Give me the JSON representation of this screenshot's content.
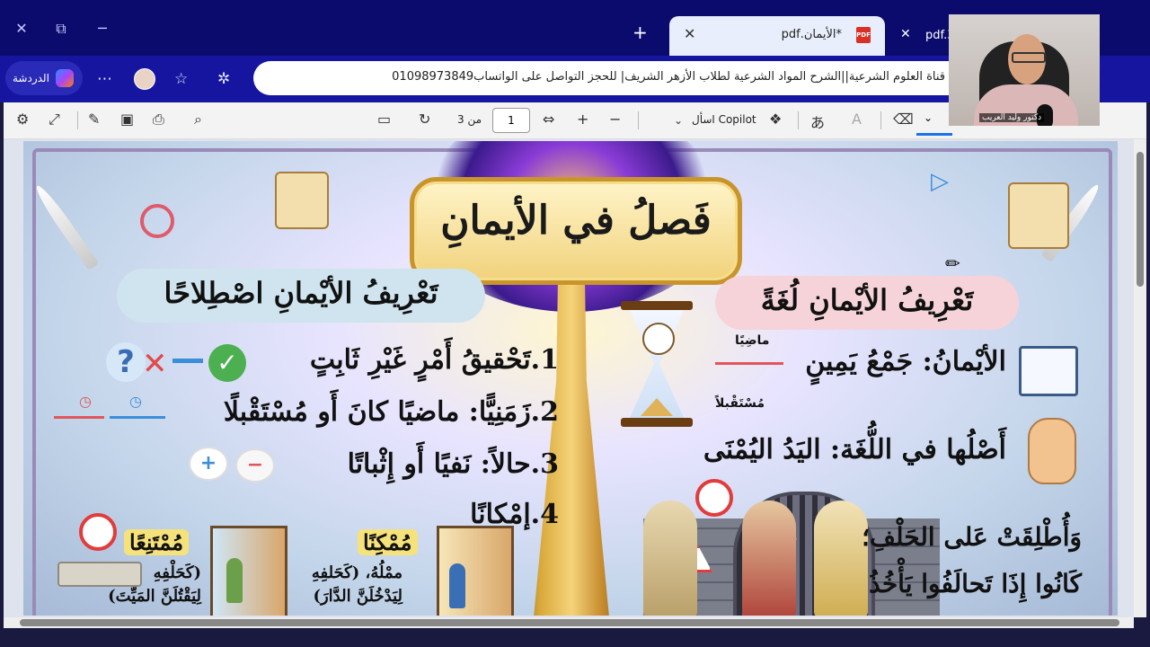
{
  "browser": {
    "tabs": [
      {
        "title": "*الأيمان.pdf",
        "active": true
      },
      {
        "title": "pdf.3"
      }
    ],
    "chat_label": "الدردشة",
    "url_text": "قناة العلوم الشرعية||الشرح المواد الشرعية لطلاب الأزهر الشريف| للحجز التواصل على الواتساب01098973849"
  },
  "pdf_toolbar": {
    "page_current": "1",
    "page_total": "من 3",
    "copilot_label": "اسأل Copilot"
  },
  "slide": {
    "title": "فَصلُ في الأيمانِ",
    "right": {
      "heading": "تَعْرِيفُ الأيْمانِ لُغَةً",
      "arrow_past": "ماضِيًا",
      "arrow_future": "مُسْتَقْبلاً",
      "line1": "الأيْمانُ: جَمْعُ يَمِينٍ",
      "line2": "أَصْلُها في اللُّغَة: اليَدُ اليُمْنَى",
      "line3": "وَأُطْلِقَتْ عَلى الحَلْفِ؛",
      "line4": "كَانُوا إِذَا تَحالَفُوا يَأْخُذُ"
    },
    "left": {
      "heading": "تَعْرِيفُ الأيْمانِ اصْطِلاحًا",
      "items": [
        "1.تَحْقيقُ أَمْرٍ غَيْرِ ثَابِتٍ",
        "2.زَمَنِيًّا: ماضيًا كانَ أَو مُسْتَقْبلًا",
        "3.حالاً: نَفيًا أَو إِثْباتًا",
        "4.إمْكانًا"
      ],
      "mumkin_label": "مُمْكِنًا",
      "mumkin_ex1": "ممْلُهُ، (كَحَلفِهِ",
      "mumkin_ex2": "لِيَدْخُلَنَّ الدَّارَ)",
      "mumtani_label": "مُمْتَنِعًا",
      "mumtani_ex1": "(كَحَلْفِهِ",
      "mumtani_ex2": "لِيَقْتُلَنَّ المَيِّتَ)"
    }
  },
  "webcam": {
    "name_label": "دكتور وليد العريب"
  },
  "icons": [
    "close-icon",
    "restore-icon",
    "minimize-icon",
    "plus-icon",
    "pdf-icon",
    "more-icon",
    "star-icon",
    "extension-icon",
    "settings-icon",
    "expand-icon",
    "edit-icon",
    "save-icon",
    "print-icon",
    "search-icon",
    "page-view-icon",
    "rotate-icon",
    "fit-width-icon",
    "zoom-in-icon",
    "zoom-out-icon",
    "copilot-icon",
    "translate-icon",
    "read-aloud-icon",
    "eraser-icon",
    "chevron-down-icon",
    "pencil-icon"
  ]
}
